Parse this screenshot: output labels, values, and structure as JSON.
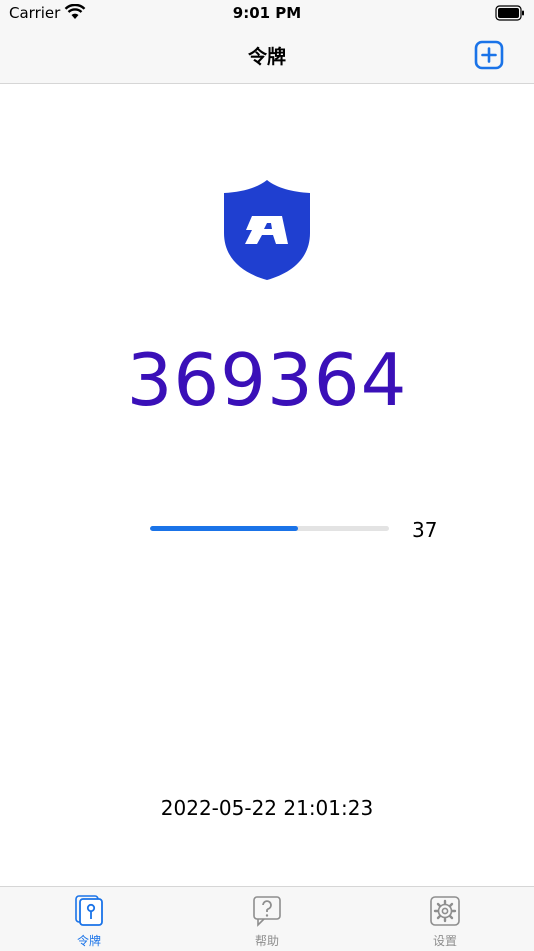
{
  "status_bar": {
    "carrier": "Carrier",
    "time": "9:01 PM"
  },
  "nav": {
    "title": "令牌",
    "add_icon": "plus-square-icon"
  },
  "token": {
    "code": "369364",
    "seconds_remaining": "37",
    "progress_fraction": 0.62
  },
  "timestamp": "2022-05-22 21:01:23",
  "tabs": [
    {
      "label": "令牌",
      "icon": "token-icon",
      "active": true
    },
    {
      "label": "帮助",
      "icon": "help-icon",
      "active": false
    },
    {
      "label": "设置",
      "icon": "gear-icon",
      "active": false
    }
  ],
  "colors": {
    "accent": "#1a73e8",
    "code": "#3a10b8",
    "logo": "#1f3fd0"
  }
}
